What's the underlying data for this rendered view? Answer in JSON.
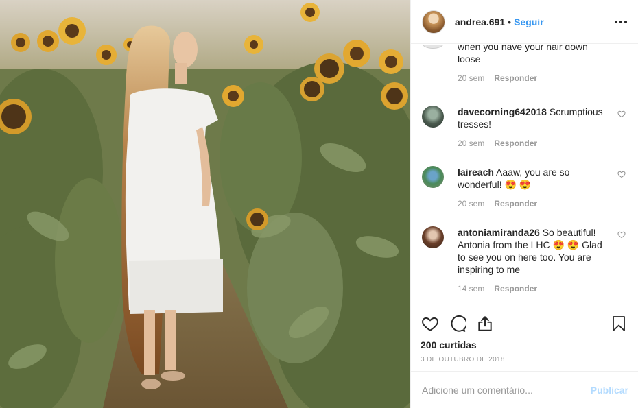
{
  "post": {
    "username": "andrea.691",
    "separator": "•",
    "follow_label": "Seguir"
  },
  "comments": [
    {
      "username": "",
      "text": "when you have your hair down loose",
      "time": "20 sem",
      "reply_label": "Responder"
    },
    {
      "username": "davecorning642018",
      "text": " Scrumptious tresses!",
      "time": "20 sem",
      "reply_label": "Responder"
    },
    {
      "username": "laireach",
      "text": " Aaaw, you are so wonderful! 😍 😍",
      "time": "20 sem",
      "reply_label": "Responder"
    },
    {
      "username": "antoniamiranda26",
      "text": " So beautiful! Antonia from the LHC 😍 😍 Glad to see you on here too. You are inspiring to me",
      "time": "14 sem",
      "reply_label": "Responder"
    }
  ],
  "stats": {
    "likes": "200 curtidas",
    "date": "3 DE OUTUBRO DE 2018"
  },
  "composer": {
    "placeholder": "Adicione um comentário...",
    "publish_label": "Publicar"
  },
  "icons": {
    "like": "heart-icon",
    "comment": "comment-icon",
    "share": "share-icon",
    "save": "bookmark-icon",
    "more": "more-options-icon"
  },
  "colors": {
    "link": "#3897f0",
    "publish_disabled": "#b3dbff",
    "muted": "#999999",
    "text": "#262626"
  }
}
